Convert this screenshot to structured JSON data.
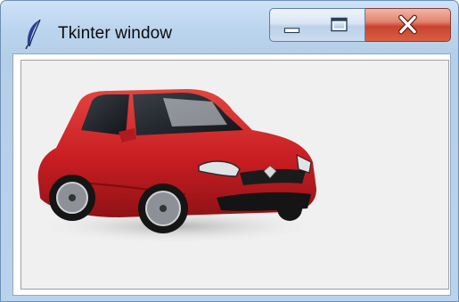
{
  "window": {
    "title": "Tkinter window",
    "app_icon": "tk-feather-icon",
    "controls": {
      "minimize": "minimize-icon",
      "maximize": "maximize-icon",
      "close": "close-icon"
    }
  },
  "content": {
    "image_subject": "red-hatchback-car",
    "car_color": "#c81d22",
    "window_bg": "#f0f0f0"
  }
}
